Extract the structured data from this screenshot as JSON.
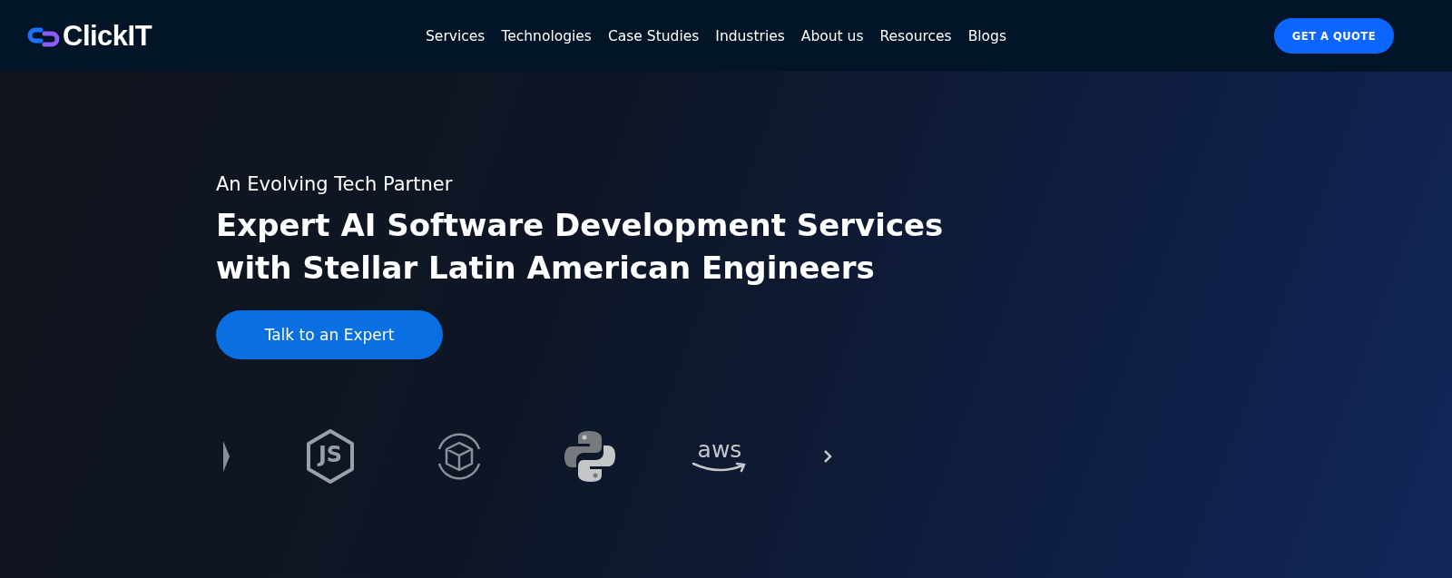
{
  "header": {
    "logo": "ClickIT",
    "nav": [
      "Services",
      "Technologies",
      "Case Studies",
      "Industries",
      "About us",
      "Resources",
      "Blogs"
    ],
    "cta": "GET A QUOTE"
  },
  "hero": {
    "eyebrow": "An Evolving Tech Partner",
    "title_lines": [
      "Expert AI Software Development Services",
      "with Stellar Latin American Engineers"
    ],
    "button": "Talk to an Expert"
  },
  "logos": [
    {
      "kind": "partial"
    },
    {
      "kind": "node",
      "text": "JS"
    },
    {
      "kind": "cube"
    },
    {
      "kind": "python"
    },
    {
      "kind": "aws",
      "text": "aws"
    },
    {
      "kind": "next"
    }
  ]
}
